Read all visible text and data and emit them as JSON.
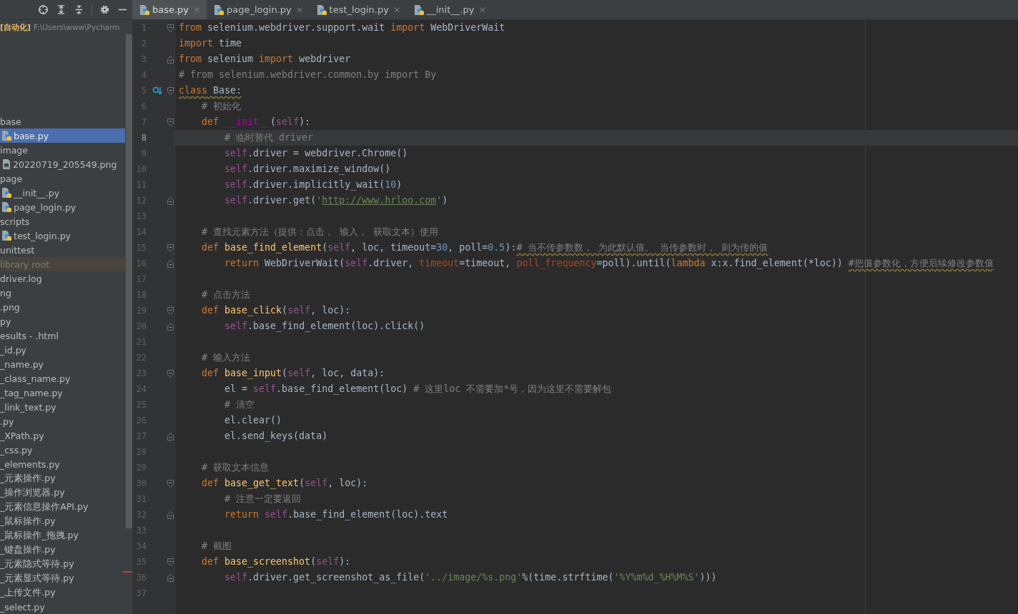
{
  "sidebar": {
    "project": {
      "name": "[自动化]",
      "path": "F:\\Users\\www\\Pycharm"
    },
    "tree": [
      {
        "label": "base",
        "kind": "folder",
        "selected": false,
        "children": [
          {
            "label": "base.py",
            "kind": "python",
            "selected": true
          }
        ]
      },
      {
        "label": "image",
        "kind": "folder",
        "selected": false,
        "children": [
          {
            "label": "20220719_205549.png",
            "kind": "image",
            "selected": false
          }
        ]
      },
      {
        "label": "page",
        "kind": "folder",
        "selected": false,
        "children": [
          {
            "label": "__init__.py",
            "kind": "python",
            "selected": false
          },
          {
            "label": "page_login.py",
            "kind": "python",
            "selected": false
          }
        ]
      },
      {
        "label": "scripts",
        "kind": "folder",
        "selected": false,
        "children": [
          {
            "label": "test_login.py",
            "kind": "python",
            "selected": false
          }
        ]
      },
      {
        "label": "unittest",
        "kind": "folder",
        "selected": false
      },
      {
        "label": "library root",
        "kind": "hint",
        "selected": false
      },
      {
        "label": "driver.log",
        "kind": "file",
        "selected": false
      },
      {
        "label": "ng",
        "kind": "file",
        "selected": false
      },
      {
        "label": ".png",
        "kind": "file",
        "selected": false
      },
      {
        "label": "py",
        "kind": "file",
        "selected": false
      },
      {
        "label": "esults - .html",
        "kind": "file",
        "selected": false
      },
      {
        "label": "_id.py",
        "kind": "file",
        "selected": false
      },
      {
        "label": "_name.py",
        "kind": "file",
        "selected": false
      },
      {
        "label": "_class_name.py",
        "kind": "file",
        "selected": false
      },
      {
        "label": "_tag_name.py",
        "kind": "file",
        "selected": false
      },
      {
        "label": "_link_text.py",
        "kind": "file",
        "selected": false
      },
      {
        "label": ".py",
        "kind": "file",
        "selected": false
      },
      {
        "label": "_XPath.py",
        "kind": "file",
        "selected": false
      },
      {
        "label": "_css.py",
        "kind": "file",
        "selected": false
      },
      {
        "label": "_elements.py",
        "kind": "file",
        "selected": false
      },
      {
        "label": "_元素操作.py",
        "kind": "file",
        "selected": false
      },
      {
        "label": "_操作浏览器.py",
        "kind": "file",
        "selected": false
      },
      {
        "label": "_元素信息操作API.py",
        "kind": "file",
        "selected": false
      },
      {
        "label": "_鼠标操作.py",
        "kind": "file",
        "selected": false
      },
      {
        "label": "_鼠标操作_拖拽.py",
        "kind": "file",
        "selected": false
      },
      {
        "label": "_键盘操作.py",
        "kind": "file",
        "selected": false
      },
      {
        "label": "_元素隐式等待.py",
        "kind": "file",
        "selected": false
      },
      {
        "label": "_元素显式等待.py",
        "kind": "file",
        "selected": false
      },
      {
        "label": "_上传文件.py",
        "kind": "file",
        "selected": false
      },
      {
        "label": "_select.py",
        "kind": "file",
        "selected": false
      }
    ]
  },
  "tabs": [
    {
      "label": "base.py",
      "selected": true
    },
    {
      "label": "page_login.py",
      "selected": false
    },
    {
      "label": "test_login.py",
      "selected": false
    },
    {
      "label": "__init__.py",
      "selected": false
    }
  ],
  "tab_close": "×",
  "editor": {
    "lines": [
      {
        "n": "1",
        "current": false,
        "fold": {
          "kind": "start"
        },
        "tokens": [
          {
            "kind": "kw",
            "text": "from"
          },
          {
            "kind": "plain",
            "text": " selenium.webdriver.support.wait "
          },
          {
            "kind": "kw",
            "text": "import"
          },
          {
            "kind": "plain",
            "text": " WebDriverWait"
          }
        ]
      },
      {
        "n": "2",
        "current": false,
        "tokens": [
          {
            "kind": "kw",
            "text": "import"
          },
          {
            "kind": "plain",
            "text": " time"
          }
        ]
      },
      {
        "n": "3",
        "current": false,
        "fold": {
          "kind": "end"
        },
        "tokens": [
          {
            "kind": "kw",
            "text": "from"
          },
          {
            "kind": "plain",
            "text": " selenium "
          },
          {
            "kind": "kw",
            "text": "import"
          },
          {
            "kind": "plain",
            "text": " webdriver"
          }
        ]
      },
      {
        "n": "4",
        "current": false,
        "tokens": [
          {
            "kind": "cmt",
            "text": "# from selenium.webdriver.common.by import By"
          }
        ]
      },
      {
        "n": "5",
        "current": false,
        "fold": {
          "kind": "start"
        },
        "marker": {
          "kind": "override"
        },
        "tokens": [
          {
            "kind": "kw-w",
            "text": "class"
          },
          {
            "kind": "plain-w",
            "text": " Base:"
          }
        ]
      },
      {
        "n": "6",
        "current": false,
        "tokens": [
          {
            "kind": "cmt",
            "text": "    # 初始化"
          }
        ]
      },
      {
        "n": "7",
        "current": false,
        "fold": {
          "kind": "start"
        },
        "tokens": [
          {
            "kind": "kw",
            "text": "    def "
          },
          {
            "kind": "magic",
            "text": "__init__"
          },
          {
            "kind": "plain",
            "text": "("
          },
          {
            "kind": "self",
            "text": "self"
          },
          {
            "kind": "plain",
            "text": "):"
          }
        ]
      },
      {
        "n": "8",
        "current": true,
        "tokens": [
          {
            "kind": "cmt",
            "text": "        # 临时替代 driver"
          }
        ]
      },
      {
        "n": "9",
        "current": false,
        "tokens": [
          {
            "kind": "self",
            "text": "        self"
          },
          {
            "kind": "plain",
            "text": ".driver = webdriver.Chrome()"
          }
        ]
      },
      {
        "n": "10",
        "current": false,
        "tokens": [
          {
            "kind": "self",
            "text": "        self"
          },
          {
            "kind": "plain",
            "text": ".driver.maximize_window()"
          }
        ]
      },
      {
        "n": "11",
        "current": false,
        "tokens": [
          {
            "kind": "self",
            "text": "        self"
          },
          {
            "kind": "plain",
            "text": ".driver.implicitly_wait("
          },
          {
            "kind": "num",
            "text": "10"
          },
          {
            "kind": "plain",
            "text": ")"
          }
        ]
      },
      {
        "n": "12",
        "current": false,
        "fold": {
          "kind": "end"
        },
        "tokens": [
          {
            "kind": "self",
            "text": "        self"
          },
          {
            "kind": "plain",
            "text": ".driver.get("
          },
          {
            "kind": "str",
            "text": "'"
          },
          {
            "kind": "str-u",
            "text": "http://www.hrloo.com"
          },
          {
            "kind": "str",
            "text": "'"
          },
          {
            "kind": "plain",
            "text": ")"
          }
        ]
      },
      {
        "n": "13",
        "current": false
      },
      {
        "n": "14",
        "current": false,
        "tokens": [
          {
            "kind": "cmt",
            "text": "    # 查找元素方法（提供：点击， 输入， 获取文本）使用"
          }
        ]
      },
      {
        "n": "15",
        "current": false,
        "fold": {
          "kind": "start"
        },
        "tokens": [
          {
            "kind": "kw",
            "text": "    def "
          },
          {
            "kind": "fn",
            "text": "base_find_element"
          },
          {
            "kind": "plain",
            "text": "("
          },
          {
            "kind": "self",
            "text": "self"
          },
          {
            "kind": "plain",
            "text": ", loc, timeout="
          },
          {
            "kind": "num",
            "text": "30"
          },
          {
            "kind": "plain",
            "text": ", poll="
          },
          {
            "kind": "num",
            "text": "0.5"
          },
          {
            "kind": "plain",
            "text": "):"
          },
          {
            "kind": "cmt-w",
            "text": "# 当不传参数数， 为此默认值。 当传参数时， 则为传的值"
          }
        ]
      },
      {
        "n": "16",
        "current": false,
        "fold": {
          "kind": "end"
        },
        "tokens": [
          {
            "kind": "kw",
            "text": "        return "
          },
          {
            "kind": "plain",
            "text": "WebDriverWait("
          },
          {
            "kind": "self",
            "text": "self"
          },
          {
            "kind": "plain",
            "text": ".driver, "
          },
          {
            "kind": "param",
            "text": "timeout"
          },
          {
            "kind": "plain",
            "text": "=timeout, "
          },
          {
            "kind": "param",
            "text": "poll_frequency"
          },
          {
            "kind": "plain",
            "text": "=poll).until("
          },
          {
            "kind": "kw",
            "text": "lambda "
          },
          {
            "kind": "plain",
            "text": "x:x.find_element(*loc)) "
          },
          {
            "kind": "cmt-w",
            "text": "#把值参数化，方便后续修改参数值"
          }
        ]
      },
      {
        "n": "17",
        "current": false
      },
      {
        "n": "18",
        "current": false,
        "tokens": [
          {
            "kind": "cmt",
            "text": "    # 点击方法"
          }
        ]
      },
      {
        "n": "19",
        "current": false,
        "fold": {
          "kind": "start"
        },
        "tokens": [
          {
            "kind": "kw",
            "text": "    def "
          },
          {
            "kind": "fn",
            "text": "base_click"
          },
          {
            "kind": "plain",
            "text": "("
          },
          {
            "kind": "self",
            "text": "self"
          },
          {
            "kind": "plain",
            "text": ", loc):"
          }
        ]
      },
      {
        "n": "20",
        "current": false,
        "fold": {
          "kind": "end"
        },
        "tokens": [
          {
            "kind": "self",
            "text": "        self"
          },
          {
            "kind": "plain",
            "text": ".base_find_element(loc).click()"
          }
        ]
      },
      {
        "n": "21",
        "current": false
      },
      {
        "n": "22",
        "current": false,
        "tokens": [
          {
            "kind": "cmt",
            "text": "    # 输入方法"
          }
        ]
      },
      {
        "n": "23",
        "current": false,
        "fold": {
          "kind": "start"
        },
        "tokens": [
          {
            "kind": "kw",
            "text": "    def "
          },
          {
            "kind": "fn",
            "text": "base_input"
          },
          {
            "kind": "plain",
            "text": "("
          },
          {
            "kind": "self",
            "text": "self"
          },
          {
            "kind": "plain",
            "text": ", loc, data):"
          }
        ]
      },
      {
        "n": "24",
        "current": false,
        "tokens": [
          {
            "kind": "plain",
            "text": "        el = "
          },
          {
            "kind": "self",
            "text": "self"
          },
          {
            "kind": "plain",
            "text": ".base_find_element(loc) "
          },
          {
            "kind": "cmt",
            "text": "# 这里loc 不需要加*号，因为这里不需要解包"
          }
        ]
      },
      {
        "n": "25",
        "current": false,
        "tokens": [
          {
            "kind": "cmt",
            "text": "        # 清空"
          }
        ]
      },
      {
        "n": "26",
        "current": false,
        "tokens": [
          {
            "kind": "plain",
            "text": "        el.clear()"
          }
        ]
      },
      {
        "n": "27",
        "current": false,
        "fold": {
          "kind": "end"
        },
        "tokens": [
          {
            "kind": "plain",
            "text": "        el.send_keys(data)"
          }
        ]
      },
      {
        "n": "28",
        "current": false
      },
      {
        "n": "29",
        "current": false,
        "tokens": [
          {
            "kind": "cmt",
            "text": "    # 获取文本信息"
          }
        ]
      },
      {
        "n": "30",
        "current": false,
        "fold": {
          "kind": "start"
        },
        "tokens": [
          {
            "kind": "kw",
            "text": "    def "
          },
          {
            "kind": "fn",
            "text": "base_get_text"
          },
          {
            "kind": "plain",
            "text": "("
          },
          {
            "kind": "self",
            "text": "self"
          },
          {
            "kind": "plain",
            "text": ", loc):"
          }
        ]
      },
      {
        "n": "31",
        "current": false,
        "tokens": [
          {
            "kind": "cmt",
            "text": "        # 注意一定要返回"
          }
        ]
      },
      {
        "n": "32",
        "current": false,
        "fold": {
          "kind": "end"
        },
        "tokens": [
          {
            "kind": "kw",
            "text": "        return "
          },
          {
            "kind": "self",
            "text": "self"
          },
          {
            "kind": "plain",
            "text": ".base_find_element(loc).text"
          }
        ]
      },
      {
        "n": "33",
        "current": false
      },
      {
        "n": "34",
        "current": false,
        "tokens": [
          {
            "kind": "cmt",
            "text": "    # 截图"
          }
        ]
      },
      {
        "n": "35",
        "current": false,
        "fold": {
          "kind": "start"
        },
        "tokens": [
          {
            "kind": "kw",
            "text": "    def "
          },
          {
            "kind": "fn",
            "text": "base_screenshot"
          },
          {
            "kind": "plain",
            "text": "("
          },
          {
            "kind": "self",
            "text": "self"
          },
          {
            "kind": "plain",
            "text": "):"
          }
        ]
      },
      {
        "n": "36",
        "current": false,
        "fold": {
          "kind": "end"
        },
        "error": true,
        "tokens": [
          {
            "kind": "self",
            "text": "        self"
          },
          {
            "kind": "plain",
            "text": ".driver.get_screenshot_as_file("
          },
          {
            "kind": "str",
            "text": "'../image/%s.png'"
          },
          {
            "kind": "plain",
            "text": "%(time.strftime("
          },
          {
            "kind": "str",
            "text": "'%Y%m%d_%H%M%S'"
          },
          {
            "kind": "plain",
            "text": ")))"
          }
        ]
      },
      {
        "n": "37",
        "current": false
      }
    ]
  }
}
